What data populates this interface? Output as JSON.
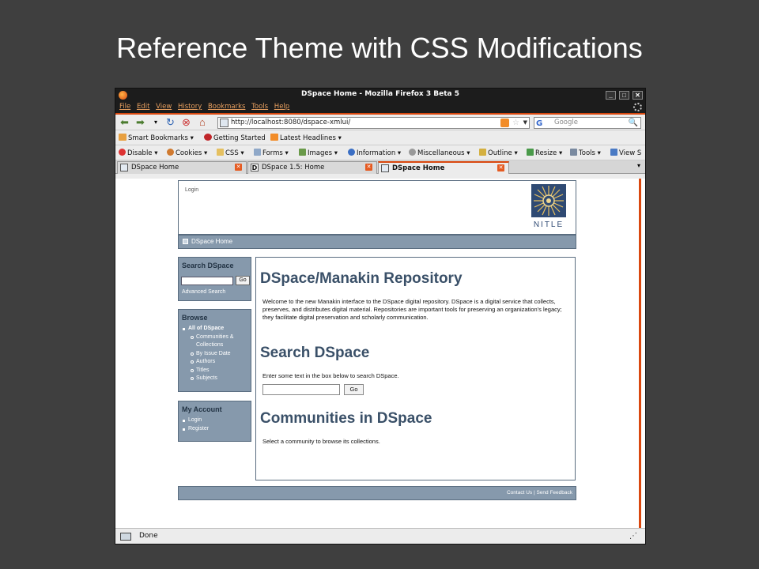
{
  "slide": {
    "title": "Reference Theme with CSS Modifications"
  },
  "window": {
    "title": "DSpace Home - Mozilla Firefox 3 Beta 5"
  },
  "menu": [
    "File",
    "Edit",
    "View",
    "History",
    "Bookmarks",
    "Tools",
    "Help"
  ],
  "nav": {
    "url": "http://localhost:8080/dspace-xmlui/",
    "search_placeholder": "Google"
  },
  "bookmarks": [
    "Smart Bookmarks",
    "Getting Started",
    "Latest Headlines"
  ],
  "devtoolbar": [
    "Disable",
    "Cookies",
    "CSS",
    "Forms",
    "Images",
    "Information",
    "Miscellaneous",
    "Outline",
    "Resize",
    "Tools",
    "View S"
  ],
  "tabs": [
    {
      "label": "DSpace Home",
      "active": false
    },
    {
      "label": "DSpace 1.5: Home",
      "active": false
    },
    {
      "label": "DSpace Home",
      "active": true
    }
  ],
  "page": {
    "login": "Login",
    "logo_text": "NITLE",
    "trail": "DSpace Home",
    "search_box": {
      "title": "Search DSpace",
      "go": "Go",
      "advanced": "Advanced Search"
    },
    "browse_box": {
      "title": "Browse",
      "items": [
        {
          "label": "All of DSpace",
          "level": 0
        },
        {
          "label": "Communities &",
          "level": 1
        },
        {
          "label": "Collections",
          "level": 2
        },
        {
          "label": "By Issue Date",
          "level": 1
        },
        {
          "label": "Authors",
          "level": 1
        },
        {
          "label": "Titles",
          "level": 1
        },
        {
          "label": "Subjects",
          "level": 1
        }
      ]
    },
    "account_box": {
      "title": "My Account",
      "items": [
        "Login",
        "Register"
      ]
    },
    "main": {
      "heading": "DSpace/Manakin Repository",
      "intro": "Welcome to the new Manakin interface to the DSpace digital repository. DSpace is a digital service that collects, preserves, and distributes digital material. Repositories are important tools for preserving an organization's legacy; they facilitate digital preservation and scholarly communication.",
      "search_heading": "Search DSpace",
      "search_text": "Enter some text in the box below to search DSpace.",
      "go": "Go",
      "communities_heading": "Communities in DSpace",
      "communities_text": "Select a community to browse its collections."
    },
    "footer": {
      "contact": "Contact Us",
      "sep": " | ",
      "feedback": "Send Feedback"
    }
  },
  "status": {
    "text": "Done"
  },
  "colors": {
    "slide_bg": "#3f3f3f",
    "theme_bar": "#8699ac",
    "theme_border": "#5a6d80",
    "heading": "#3a5068",
    "firefox_accent": "#d9480f"
  }
}
